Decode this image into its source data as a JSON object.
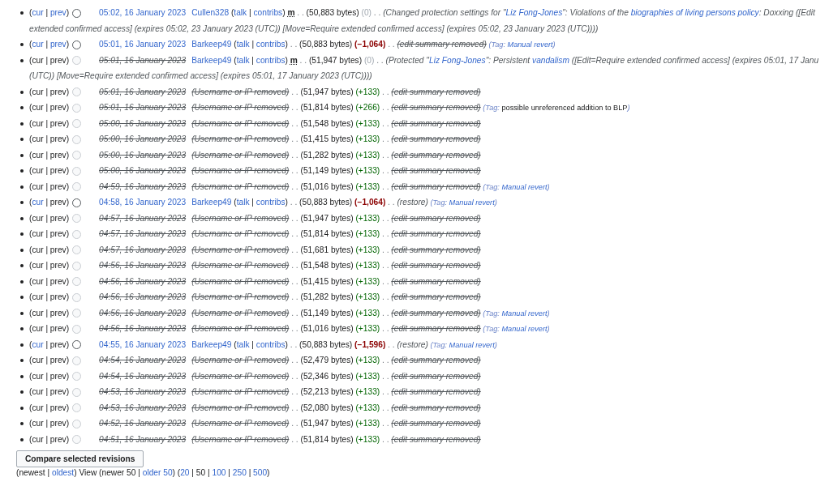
{
  "revisions": [
    {
      "nav": [
        {
          "text": "(",
          "kind": "plain"
        },
        {
          "text": "cur",
          "kind": "link"
        },
        {
          "text": " | ",
          "kind": "plain"
        },
        {
          "text": "prev",
          "kind": "link"
        },
        {
          "text": ")",
          "kind": "plain"
        }
      ],
      "radio_disabled": false,
      "body": [
        {
          "text": "05:02, 16 January 2023",
          "kind": "date"
        },
        {
          "text": "Cullen328",
          "kind": "user"
        },
        {
          "text": " (",
          "kind": "plain"
        },
        {
          "text": "talk",
          "kind": "link"
        },
        {
          "text": " | ",
          "kind": "plain"
        },
        {
          "text": "contribs",
          "kind": "link"
        },
        {
          "text": ") ",
          "kind": "plain"
        },
        {
          "text": "m",
          "kind": "minor"
        },
        {
          "text": " . . ",
          "kind": "dots"
        },
        {
          "text": "(50,883 bytes) ",
          "kind": "plain"
        },
        {
          "text": "(0)",
          "kind": "zero"
        },
        {
          "text": " . . ",
          "kind": "dots"
        },
        {
          "text": "(Changed protection settings for \"",
          "kind": "summary"
        },
        {
          "text": "Liz Fong-Jones",
          "kind": "summarylink"
        },
        {
          "text": "\": Violations of the ",
          "kind": "summary"
        },
        {
          "text": "biographies of living persons policy",
          "kind": "summarylink"
        },
        {
          "text": ": Doxxing ([Edit",
          "kind": "summary"
        },
        {
          "text": "extended confirmed access] (expires 05:02, 23 January 2023 (UTC)) [Move=Require extended confirmed access] (expires 05:02, 23 January 2023 (UTC))))",
          "kind": "summarybreak"
        }
      ]
    },
    {
      "nav": [
        {
          "text": "(",
          "kind": "plain"
        },
        {
          "text": "cur",
          "kind": "link"
        },
        {
          "text": " | ",
          "kind": "plain"
        },
        {
          "text": "prev",
          "kind": "link"
        },
        {
          "text": ")",
          "kind": "plain"
        }
      ],
      "radio_disabled": false,
      "body": [
        {
          "text": "05:01, 16 January 2023",
          "kind": "date"
        },
        {
          "text": "Barkeep49",
          "kind": "user"
        },
        {
          "text": " (",
          "kind": "plain"
        },
        {
          "text": "talk",
          "kind": "link"
        },
        {
          "text": " | ",
          "kind": "plain"
        },
        {
          "text": "contribs",
          "kind": "link"
        },
        {
          "text": ")",
          "kind": "plain"
        },
        {
          "text": " . . ",
          "kind": "dots"
        },
        {
          "text": "(50,883 bytes) ",
          "kind": "plain"
        },
        {
          "text": "(−1,064)",
          "kind": "loss"
        },
        {
          "text": " . . ",
          "kind": "dots"
        },
        {
          "text": "(edit summary removed)",
          "kind": "delsummary"
        },
        {
          "text": " (Tag: ",
          "kind": "taglabel"
        },
        {
          "text": "Manual revert",
          "kind": "taglink"
        },
        {
          "text": ")",
          "kind": "taglabel"
        }
      ]
    },
    {
      "nav": [
        {
          "text": "(cur | prev)",
          "kind": "plain"
        }
      ],
      "radio_disabled": true,
      "body": [
        {
          "text": "05:01, 16 January 2023",
          "kind": "deldate"
        },
        {
          "text": "Barkeep49",
          "kind": "user"
        },
        {
          "text": " (",
          "kind": "plain"
        },
        {
          "text": "talk",
          "kind": "link"
        },
        {
          "text": " | ",
          "kind": "plain"
        },
        {
          "text": "contribs",
          "kind": "link"
        },
        {
          "text": ") ",
          "kind": "plain"
        },
        {
          "text": "m",
          "kind": "minor"
        },
        {
          "text": " . . ",
          "kind": "dots"
        },
        {
          "text": "(51,947 bytes) ",
          "kind": "plain"
        },
        {
          "text": "(0)",
          "kind": "zero"
        },
        {
          "text": " . . ",
          "kind": "dots"
        },
        {
          "text": "(Protected \"",
          "kind": "summary"
        },
        {
          "text": "Liz Fong-Jones",
          "kind": "summarylink"
        },
        {
          "text": "\": Persistent ",
          "kind": "summary"
        },
        {
          "text": "vandalism",
          "kind": "summarylink"
        },
        {
          "text": " ([Edit=Require extended confirmed access] (expires 05:01, 17 Janu",
          "kind": "summary"
        },
        {
          "text": "(UTC)) [Move=Require extended confirmed access] (expires 05:01, 17 January 2023 (UTC))))",
          "kind": "summarybreak"
        }
      ]
    },
    {
      "nav": [
        {
          "text": "(cur | prev)",
          "kind": "plain"
        }
      ],
      "radio_disabled": true,
      "body": [
        {
          "text": "05:01, 16 January 2023",
          "kind": "deldate"
        },
        {
          "text": "(Username or IP removed)",
          "kind": "deluser"
        },
        {
          "text": " . . ",
          "kind": "dots"
        },
        {
          "text": "(51,947 bytes) ",
          "kind": "plain"
        },
        {
          "text": "(+133)",
          "kind": "gain"
        },
        {
          "text": " . . ",
          "kind": "dots"
        },
        {
          "text": "(edit summary removed)",
          "kind": "delsummary"
        }
      ]
    },
    {
      "nav": [
        {
          "text": "(cur | prev)",
          "kind": "plain"
        }
      ],
      "radio_disabled": true,
      "body": [
        {
          "text": "05:01, 16 January 2023",
          "kind": "deldate"
        },
        {
          "text": "(Username or IP removed)",
          "kind": "deluser"
        },
        {
          "text": " . . ",
          "kind": "dots"
        },
        {
          "text": "(51,814 bytes) ",
          "kind": "plain"
        },
        {
          "text": "(+266)",
          "kind": "gain"
        },
        {
          "text": " . . ",
          "kind": "dots"
        },
        {
          "text": "(edit summary removed)",
          "kind": "delsummary"
        },
        {
          "text": " (Tag: ",
          "kind": "taglabel"
        },
        {
          "text": "possible unreferenced addition to BLP",
          "kind": "tagtext"
        },
        {
          "text": ")",
          "kind": "taglabel"
        }
      ]
    },
    {
      "nav": [
        {
          "text": "(cur | prev)",
          "kind": "plain"
        }
      ],
      "radio_disabled": true,
      "body": [
        {
          "text": "05:00, 16 January 2023",
          "kind": "deldate"
        },
        {
          "text": "(Username or IP removed)",
          "kind": "deluser"
        },
        {
          "text": " . . ",
          "kind": "dots"
        },
        {
          "text": "(51,548 bytes) ",
          "kind": "plain"
        },
        {
          "text": "(+133)",
          "kind": "gain"
        },
        {
          "text": " . . ",
          "kind": "dots"
        },
        {
          "text": "(edit summary removed)",
          "kind": "delsummary"
        }
      ]
    },
    {
      "nav": [
        {
          "text": "(cur | prev)",
          "kind": "plain"
        }
      ],
      "radio_disabled": true,
      "body": [
        {
          "text": "05:00, 16 January 2023",
          "kind": "deldate"
        },
        {
          "text": "(Username or IP removed)",
          "kind": "deluser"
        },
        {
          "text": " . . ",
          "kind": "dots"
        },
        {
          "text": "(51,415 bytes) ",
          "kind": "plain"
        },
        {
          "text": "(+133)",
          "kind": "gain"
        },
        {
          "text": " . . ",
          "kind": "dots"
        },
        {
          "text": "(edit summary removed)",
          "kind": "delsummary"
        }
      ]
    },
    {
      "nav": [
        {
          "text": "(cur | prev)",
          "kind": "plain"
        }
      ],
      "radio_disabled": true,
      "body": [
        {
          "text": "05:00, 16 January 2023",
          "kind": "deldate"
        },
        {
          "text": "(Username or IP removed)",
          "kind": "deluser"
        },
        {
          "text": " . . ",
          "kind": "dots"
        },
        {
          "text": "(51,282 bytes) ",
          "kind": "plain"
        },
        {
          "text": "(+133)",
          "kind": "gain"
        },
        {
          "text": " . . ",
          "kind": "dots"
        },
        {
          "text": "(edit summary removed)",
          "kind": "delsummary"
        }
      ]
    },
    {
      "nav": [
        {
          "text": "(cur | prev)",
          "kind": "plain"
        }
      ],
      "radio_disabled": true,
      "body": [
        {
          "text": "05:00, 16 January 2023",
          "kind": "deldate"
        },
        {
          "text": "(Username or IP removed)",
          "kind": "deluser"
        },
        {
          "text": " . . ",
          "kind": "dots"
        },
        {
          "text": "(51,149 bytes) ",
          "kind": "plain"
        },
        {
          "text": "(+133)",
          "kind": "gain"
        },
        {
          "text": " . . ",
          "kind": "dots"
        },
        {
          "text": "(edit summary removed)",
          "kind": "delsummary"
        }
      ]
    },
    {
      "nav": [
        {
          "text": "(cur | prev)",
          "kind": "plain"
        }
      ],
      "radio_disabled": true,
      "body": [
        {
          "text": "04:59, 16 January 2023",
          "kind": "deldate"
        },
        {
          "text": "(Username or IP removed)",
          "kind": "deluser"
        },
        {
          "text": " . . ",
          "kind": "dots"
        },
        {
          "text": "(51,016 bytes) ",
          "kind": "plain"
        },
        {
          "text": "(+133)",
          "kind": "gain"
        },
        {
          "text": " . . ",
          "kind": "dots"
        },
        {
          "text": "(edit summary removed)",
          "kind": "delsummary"
        },
        {
          "text": " (Tag: ",
          "kind": "taglabel"
        },
        {
          "text": "Manual revert",
          "kind": "taglink"
        },
        {
          "text": ")",
          "kind": "taglabel"
        }
      ]
    },
    {
      "nav": [
        {
          "text": "(",
          "kind": "plain"
        },
        {
          "text": "cur",
          "kind": "link"
        },
        {
          "text": " | prev)",
          "kind": "plain"
        }
      ],
      "radio_disabled": false,
      "body": [
        {
          "text": "04:58, 16 January 2023",
          "kind": "date"
        },
        {
          "text": "Barkeep49",
          "kind": "user"
        },
        {
          "text": " (",
          "kind": "plain"
        },
        {
          "text": "talk",
          "kind": "link"
        },
        {
          "text": " | ",
          "kind": "plain"
        },
        {
          "text": "contribs",
          "kind": "link"
        },
        {
          "text": ")",
          "kind": "plain"
        },
        {
          "text": " . . ",
          "kind": "dots"
        },
        {
          "text": "(50,883 bytes) ",
          "kind": "plain"
        },
        {
          "text": "(−1,064)",
          "kind": "loss"
        },
        {
          "text": " . . ",
          "kind": "dots"
        },
        {
          "text": "(restore)",
          "kind": "summary"
        },
        {
          "text": " (Tag: ",
          "kind": "taglabel"
        },
        {
          "text": "Manual revert",
          "kind": "taglink"
        },
        {
          "text": ")",
          "kind": "taglabel"
        }
      ]
    },
    {
      "nav": [
        {
          "text": "(cur | prev)",
          "kind": "plain"
        }
      ],
      "radio_disabled": true,
      "body": [
        {
          "text": "04:57, 16 January 2023",
          "kind": "deldate"
        },
        {
          "text": "(Username or IP removed)",
          "kind": "deluser"
        },
        {
          "text": " . . ",
          "kind": "dots"
        },
        {
          "text": "(51,947 bytes) ",
          "kind": "plain"
        },
        {
          "text": "(+133)",
          "kind": "gain"
        },
        {
          "text": " . . ",
          "kind": "dots"
        },
        {
          "text": "(edit summary removed)",
          "kind": "delsummary"
        }
      ]
    },
    {
      "nav": [
        {
          "text": "(cur | prev)",
          "kind": "plain"
        }
      ],
      "radio_disabled": true,
      "body": [
        {
          "text": "04:57, 16 January 2023",
          "kind": "deldate"
        },
        {
          "text": "(Username or IP removed)",
          "kind": "deluser"
        },
        {
          "text": " . . ",
          "kind": "dots"
        },
        {
          "text": "(51,814 bytes) ",
          "kind": "plain"
        },
        {
          "text": "(+133)",
          "kind": "gain"
        },
        {
          "text": " . . ",
          "kind": "dots"
        },
        {
          "text": "(edit summary removed)",
          "kind": "delsummary"
        }
      ]
    },
    {
      "nav": [
        {
          "text": "(cur | prev)",
          "kind": "plain"
        }
      ],
      "radio_disabled": true,
      "body": [
        {
          "text": "04:57, 16 January 2023",
          "kind": "deldate"
        },
        {
          "text": "(Username or IP removed)",
          "kind": "deluser"
        },
        {
          "text": " . . ",
          "kind": "dots"
        },
        {
          "text": "(51,681 bytes) ",
          "kind": "plain"
        },
        {
          "text": "(+133)",
          "kind": "gain"
        },
        {
          "text": " . . ",
          "kind": "dots"
        },
        {
          "text": "(edit summary removed)",
          "kind": "delsummary"
        }
      ]
    },
    {
      "nav": [
        {
          "text": "(cur | prev)",
          "kind": "plain"
        }
      ],
      "radio_disabled": true,
      "body": [
        {
          "text": "04:56, 16 January 2023",
          "kind": "deldate"
        },
        {
          "text": "(Username or IP removed)",
          "kind": "deluser"
        },
        {
          "text": " . . ",
          "kind": "dots"
        },
        {
          "text": "(51,548 bytes) ",
          "kind": "plain"
        },
        {
          "text": "(+133)",
          "kind": "gain"
        },
        {
          "text": " . . ",
          "kind": "dots"
        },
        {
          "text": "(edit summary removed)",
          "kind": "delsummary"
        }
      ]
    },
    {
      "nav": [
        {
          "text": "(cur | prev)",
          "kind": "plain"
        }
      ],
      "radio_disabled": true,
      "body": [
        {
          "text": "04:56, 16 January 2023",
          "kind": "deldate"
        },
        {
          "text": "(Username or IP removed)",
          "kind": "deluser"
        },
        {
          "text": " . . ",
          "kind": "dots"
        },
        {
          "text": "(51,415 bytes) ",
          "kind": "plain"
        },
        {
          "text": "(+133)",
          "kind": "gain"
        },
        {
          "text": " . . ",
          "kind": "dots"
        },
        {
          "text": "(edit summary removed)",
          "kind": "delsummary"
        }
      ]
    },
    {
      "nav": [
        {
          "text": "(cur | prev)",
          "kind": "plain"
        }
      ],
      "radio_disabled": true,
      "body": [
        {
          "text": "04:56, 16 January 2023",
          "kind": "deldate"
        },
        {
          "text": "(Username or IP removed)",
          "kind": "deluser"
        },
        {
          "text": " . . ",
          "kind": "dots"
        },
        {
          "text": "(51,282 bytes) ",
          "kind": "plain"
        },
        {
          "text": "(+133)",
          "kind": "gain"
        },
        {
          "text": " . . ",
          "kind": "dots"
        },
        {
          "text": "(edit summary removed)",
          "kind": "delsummary"
        }
      ]
    },
    {
      "nav": [
        {
          "text": "(cur | prev)",
          "kind": "plain"
        }
      ],
      "radio_disabled": true,
      "body": [
        {
          "text": "04:56, 16 January 2023",
          "kind": "deldate"
        },
        {
          "text": "(Username or IP removed)",
          "kind": "deluser"
        },
        {
          "text": " . . ",
          "kind": "dots"
        },
        {
          "text": "(51,149 bytes) ",
          "kind": "plain"
        },
        {
          "text": "(+133)",
          "kind": "gain"
        },
        {
          "text": " . . ",
          "kind": "dots"
        },
        {
          "text": "(edit summary removed)",
          "kind": "delsummary"
        },
        {
          "text": " (Tag: ",
          "kind": "taglabel"
        },
        {
          "text": "Manual revert",
          "kind": "taglink"
        },
        {
          "text": ")",
          "kind": "taglabel"
        }
      ]
    },
    {
      "nav": [
        {
          "text": "(cur | prev)",
          "kind": "plain"
        }
      ],
      "radio_disabled": true,
      "body": [
        {
          "text": "04:56, 16 January 2023",
          "kind": "deldate"
        },
        {
          "text": "(Username or IP removed)",
          "kind": "deluser"
        },
        {
          "text": " . . ",
          "kind": "dots"
        },
        {
          "text": "(51,016 bytes) ",
          "kind": "plain"
        },
        {
          "text": "(+133)",
          "kind": "gain"
        },
        {
          "text": " . . ",
          "kind": "dots"
        },
        {
          "text": "(edit summary removed)",
          "kind": "delsummary"
        },
        {
          "text": " (Tag: ",
          "kind": "taglabel"
        },
        {
          "text": "Manual revert",
          "kind": "taglink"
        },
        {
          "text": ")",
          "kind": "taglabel"
        }
      ]
    },
    {
      "nav": [
        {
          "text": "(",
          "kind": "plain"
        },
        {
          "text": "cur",
          "kind": "link"
        },
        {
          "text": " | prev)",
          "kind": "plain"
        }
      ],
      "radio_disabled": false,
      "body": [
        {
          "text": "04:55, 16 January 2023",
          "kind": "date"
        },
        {
          "text": "Barkeep49",
          "kind": "user"
        },
        {
          "text": " (",
          "kind": "plain"
        },
        {
          "text": "talk",
          "kind": "link"
        },
        {
          "text": " | ",
          "kind": "plain"
        },
        {
          "text": "contribs",
          "kind": "link"
        },
        {
          "text": ")",
          "kind": "plain"
        },
        {
          "text": " . . ",
          "kind": "dots"
        },
        {
          "text": "(50,883 bytes) ",
          "kind": "plain"
        },
        {
          "text": "(−1,596)",
          "kind": "loss"
        },
        {
          "text": " . . ",
          "kind": "dots"
        },
        {
          "text": "(restore)",
          "kind": "summary"
        },
        {
          "text": " (Tag: ",
          "kind": "taglabel"
        },
        {
          "text": "Manual revert",
          "kind": "taglink"
        },
        {
          "text": ")",
          "kind": "taglabel"
        }
      ]
    },
    {
      "nav": [
        {
          "text": "(cur | prev)",
          "kind": "plain"
        }
      ],
      "radio_disabled": true,
      "body": [
        {
          "text": "04:54, 16 January 2023",
          "kind": "deldate"
        },
        {
          "text": "(Username or IP removed)",
          "kind": "deluser"
        },
        {
          "text": " . . ",
          "kind": "dots"
        },
        {
          "text": "(52,479 bytes) ",
          "kind": "plain"
        },
        {
          "text": "(+133)",
          "kind": "gain"
        },
        {
          "text": " . . ",
          "kind": "dots"
        },
        {
          "text": "(edit summary removed)",
          "kind": "delsummary"
        }
      ]
    },
    {
      "nav": [
        {
          "text": "(cur | prev)",
          "kind": "plain"
        }
      ],
      "radio_disabled": true,
      "body": [
        {
          "text": "04:54, 16 January 2023",
          "kind": "deldate"
        },
        {
          "text": "(Username or IP removed)",
          "kind": "deluser"
        },
        {
          "text": " . . ",
          "kind": "dots"
        },
        {
          "text": "(52,346 bytes) ",
          "kind": "plain"
        },
        {
          "text": "(+133)",
          "kind": "gain"
        },
        {
          "text": " . . ",
          "kind": "dots"
        },
        {
          "text": "(edit summary removed)",
          "kind": "delsummary"
        }
      ]
    },
    {
      "nav": [
        {
          "text": "(cur | prev)",
          "kind": "plain"
        }
      ],
      "radio_disabled": true,
      "body": [
        {
          "text": "04:53, 16 January 2023",
          "kind": "deldate"
        },
        {
          "text": "(Username or IP removed)",
          "kind": "deluser"
        },
        {
          "text": " . . ",
          "kind": "dots"
        },
        {
          "text": "(52,213 bytes) ",
          "kind": "plain"
        },
        {
          "text": "(+133)",
          "kind": "gain"
        },
        {
          "text": " . . ",
          "kind": "dots"
        },
        {
          "text": "(edit summary removed)",
          "kind": "delsummary"
        }
      ]
    },
    {
      "nav": [
        {
          "text": "(cur | prev)",
          "kind": "plain"
        }
      ],
      "radio_disabled": true,
      "body": [
        {
          "text": "04:53, 16 January 2023",
          "kind": "deldate"
        },
        {
          "text": "(Username or IP removed)",
          "kind": "deluser"
        },
        {
          "text": " . . ",
          "kind": "dots"
        },
        {
          "text": "(52,080 bytes) ",
          "kind": "plain"
        },
        {
          "text": "(+133)",
          "kind": "gain"
        },
        {
          "text": " . . ",
          "kind": "dots"
        },
        {
          "text": "(edit summary removed)",
          "kind": "delsummary"
        }
      ]
    },
    {
      "nav": [
        {
          "text": "(cur | prev)",
          "kind": "plain"
        }
      ],
      "radio_disabled": true,
      "body": [
        {
          "text": "04:52, 16 January 2023",
          "kind": "deldate"
        },
        {
          "text": "(Username or IP removed)",
          "kind": "deluser"
        },
        {
          "text": " . . ",
          "kind": "dots"
        },
        {
          "text": "(51,947 bytes) ",
          "kind": "plain"
        },
        {
          "text": "(+133)",
          "kind": "gain"
        },
        {
          "text": " . . ",
          "kind": "dots"
        },
        {
          "text": "(edit summary removed)",
          "kind": "delsummary"
        }
      ]
    },
    {
      "nav": [
        {
          "text": "(cur | prev)",
          "kind": "plain"
        }
      ],
      "radio_disabled": true,
      "body": [
        {
          "text": "04:51, 16 January 2023",
          "kind": "deldate"
        },
        {
          "text": "(Username or IP removed)",
          "kind": "deluser"
        },
        {
          "text": " . . ",
          "kind": "dots"
        },
        {
          "text": "(51,814 bytes) ",
          "kind": "plain"
        },
        {
          "text": "(+133)",
          "kind": "gain"
        },
        {
          "text": " . . ",
          "kind": "dots"
        },
        {
          "text": "(edit summary removed)",
          "kind": "delsummary"
        }
      ]
    }
  ],
  "compare_button": "Compare selected revisions",
  "pager": [
    {
      "text": "(newest | ",
      "kind": "plain"
    },
    {
      "text": "oldest",
      "kind": "link"
    },
    {
      "text": ") View (newer 50 | ",
      "kind": "plain"
    },
    {
      "text": "older 50",
      "kind": "link"
    },
    {
      "text": ") (",
      "kind": "plain"
    },
    {
      "text": "20",
      "kind": "link"
    },
    {
      "text": " | 50 | ",
      "kind": "plain"
    },
    {
      "text": "100",
      "kind": "link"
    },
    {
      "text": " | ",
      "kind": "plain"
    },
    {
      "text": "250",
      "kind": "link"
    },
    {
      "text": " | ",
      "kind": "plain"
    },
    {
      "text": "500",
      "kind": "link"
    },
    {
      "text": ")",
      "kind": "plain"
    }
  ]
}
